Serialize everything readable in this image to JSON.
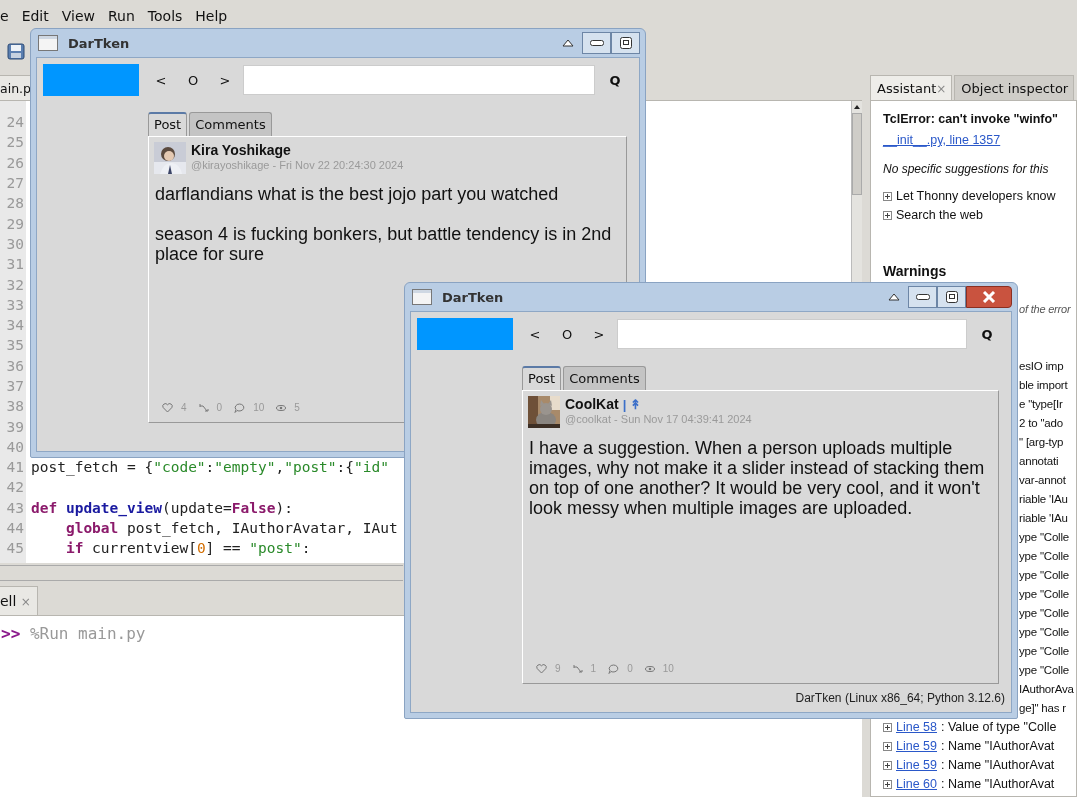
{
  "menu": [
    "e",
    "Edit",
    "View",
    "Run",
    "Tools",
    "Help"
  ],
  "editor": {
    "tab": "ain.p",
    "lines": [
      {
        "n": "24"
      },
      {
        "n": "25"
      },
      {
        "n": "26"
      },
      {
        "n": "27"
      },
      {
        "n": "28"
      },
      {
        "n": "29"
      },
      {
        "n": "30"
      },
      {
        "n": "31"
      },
      {
        "n": "32"
      },
      {
        "n": "33"
      },
      {
        "n": "34"
      },
      {
        "n": "35"
      },
      {
        "n": "36"
      },
      {
        "n": "37"
      },
      {
        "n": "38"
      },
      {
        "n": "39"
      },
      {
        "n": "40"
      },
      {
        "n": "41",
        "code": [
          {
            "text": "post_fetch = {",
            "kind": "plain"
          },
          {
            "text": "\"code\"",
            "kind": "str"
          },
          {
            "text": ":",
            "kind": "plain"
          },
          {
            "text": "\"empty\"",
            "kind": "str"
          },
          {
            "text": ",",
            "kind": "plain"
          },
          {
            "text": "\"post\"",
            "kind": "str"
          },
          {
            "text": ":{",
            "kind": "plain"
          },
          {
            "text": "\"id\"",
            "kind": "str"
          }
        ]
      },
      {
        "n": "42"
      },
      {
        "n": "43",
        "code": [
          {
            "text": "def ",
            "kind": "kw"
          },
          {
            "text": "update_view",
            "kind": "fn"
          },
          {
            "text": "(update=",
            "kind": "plain"
          },
          {
            "text": "False",
            "kind": "const"
          },
          {
            "text": "):",
            "kind": "plain"
          }
        ]
      },
      {
        "n": "44",
        "code": [
          {
            "text": "    global ",
            "kind": "kw"
          },
          {
            "text": "post_fetch, IAuthorAvatar, IAut",
            "kind": "plain"
          }
        ]
      },
      {
        "n": "45",
        "code": [
          {
            "text": "    if ",
            "kind": "kw"
          },
          {
            "text": "currentview[",
            "kind": "plain"
          },
          {
            "text": "0",
            "kind": "num"
          },
          {
            "text": "] == ",
            "kind": "plain"
          },
          {
            "text": "\"post\"",
            "kind": "str"
          },
          {
            "text": ":",
            "kind": "plain"
          }
        ]
      }
    ]
  },
  "shell": {
    "tab": "ell",
    "close": "×",
    "prompt": ">>",
    "command": "%Run main.py"
  },
  "side_panel": {
    "tabs": [
      {
        "label": "Assistant",
        "close": "×",
        "selected": true
      },
      {
        "label": "Object inspector",
        "selected": false
      }
    ],
    "items": [
      {
        "kind": "error",
        "text": "TclError: can't invoke \"winfo\""
      },
      {
        "kind": "link",
        "text": "__init__.py, line 1357"
      },
      {
        "kind": "note",
        "text": "No specific suggestions for this"
      },
      {
        "kind": "expander",
        "text": "Let Thonny developers know"
      },
      {
        "kind": "expander",
        "text": "Search the web"
      },
      {
        "kind": "heading",
        "text": "Warnings"
      },
      {
        "kind": "note",
        "text": "of the error"
      },
      {
        "kind": "fragment",
        "text": "esIO imp"
      },
      {
        "kind": "fragment",
        "text": "ble import"
      },
      {
        "kind": "fragment",
        "text": "e \"type[Ir"
      },
      {
        "kind": "fragment",
        "text": "2 to \"ado"
      },
      {
        "kind": "fragment",
        "text": "\" [arg-typ"
      },
      {
        "kind": "fragment",
        "text": "annotati"
      },
      {
        "kind": "fragment",
        "text": "var-annot"
      },
      {
        "kind": "fragment",
        "text": "riable 'IAu"
      },
      {
        "kind": "fragment",
        "text": "riable 'IAu"
      },
      {
        "kind": "fragment",
        "text": "ype \"Colle"
      },
      {
        "kind": "fragment",
        "text": "ype \"Colle"
      },
      {
        "kind": "fragment",
        "text": "ype \"Colle"
      },
      {
        "kind": "fragment",
        "text": "ype \"Colle"
      },
      {
        "kind": "fragment",
        "text": "ype \"Colle"
      },
      {
        "kind": "fragment",
        "text": "ype \"Colle"
      },
      {
        "kind": "fragment",
        "text": "ype \"Colle"
      },
      {
        "kind": "fragment",
        "text": "ype \"Colle"
      },
      {
        "kind": "fragment",
        "text": "IAuthorAva"
      },
      {
        "kind": "fragment",
        "text": "ge]\" has r"
      },
      {
        "kind": "line",
        "link": "Line 58",
        "text": ": Value of type \"Colle"
      },
      {
        "kind": "line",
        "link": "Line 59",
        "text": ": Name \"IAuthorAvat"
      },
      {
        "kind": "line",
        "link": "Line 59",
        "text": ": Name \"IAuthorAvat"
      },
      {
        "kind": "line",
        "link": "Line 60",
        "text": ": Name \"IAuthorAvat"
      }
    ]
  },
  "windows": [
    {
      "title": "DarTken",
      "closable": false,
      "nav": [
        "<",
        "O",
        ">"
      ],
      "search_button": "Q",
      "tabs": [
        {
          "label": "Post",
          "selected": true
        },
        {
          "label": "Comments",
          "selected": false
        }
      ],
      "post": {
        "name": "Kira Yoshikage",
        "meta": "@kirayoshikage - Fri Nov 22 20:24:30 2024",
        "paragraphs": [
          "darflandians what is the best jojo part you watched",
          "season 4 is fucking bonkers, but battle tendency is in 2nd place for sure"
        ],
        "stats": [
          {
            "kind": "likes",
            "count": "4"
          },
          {
            "kind": "reposts",
            "count": "0"
          },
          {
            "kind": "comments",
            "count": "10"
          },
          {
            "kind": "views",
            "count": "5"
          }
        ]
      }
    },
    {
      "title": "DarTken",
      "closable": true,
      "nav": [
        "<",
        "O",
        ">"
      ],
      "search_button": "Q",
      "tabs": [
        {
          "label": "Post",
          "selected": true
        },
        {
          "label": "Comments",
          "selected": false
        }
      ],
      "post": {
        "name": "CoolKat",
        "flair": "| ↟",
        "meta": "@coolkat - Sun Nov 17 04:39:41 2024",
        "paragraphs": [
          "I have a suggestion. When a person uploads multiple images, why not make it a slider instead of stacking them on top of one another? It would be very cool, and it won't look messy when multiple images are uploaded."
        ],
        "stats": [
          {
            "kind": "likes",
            "count": "9"
          },
          {
            "kind": "reposts",
            "count": "1"
          },
          {
            "kind": "comments",
            "count": "0"
          },
          {
            "kind": "views",
            "count": "10"
          }
        ]
      },
      "status": "DarTken (Linux x86_64; Python 3.12.6)"
    }
  ]
}
